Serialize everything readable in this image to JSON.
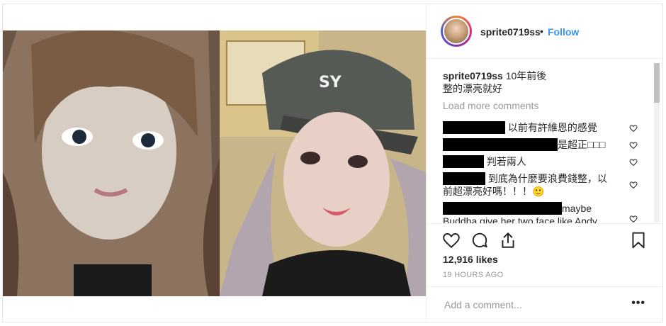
{
  "post": {
    "username": "sprite0719ss",
    "dot": "•",
    "follow_label": "Follow"
  },
  "caption": {
    "username": "sprite0719ss",
    "text_line1": "10年前後",
    "text_line2": "整的漂亮就好"
  },
  "load_more_label": "Load more comments",
  "comments": [
    {
      "text": "以前有許維恩的感覺"
    },
    {
      "text": "是超正□□□"
    },
    {
      "text": "判若兩人"
    },
    {
      "text_line1": "到底為什麼要浪費錢整，以",
      "text_line2": "前超漂亮好嗎！！！🙂"
    },
    {
      "text_line1": "maybe",
      "text_line2": "Buddha give her two face like Andy"
    }
  ],
  "likes": "12,916 likes",
  "timestamp": "19 HOURS AGO",
  "add_comment_placeholder": "Add a comment...",
  "more_options": "•••",
  "icons": [
    "heart-icon",
    "comment-icon",
    "share-icon",
    "bookmark-icon"
  ],
  "colors": {
    "accent": "#3897f0",
    "text": "#262626",
    "muted": "#999999",
    "border": "#efefef"
  }
}
